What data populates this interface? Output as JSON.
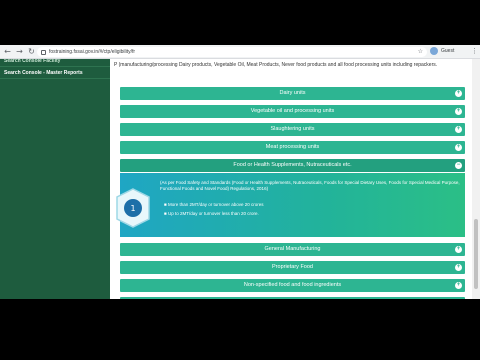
{
  "browser": {
    "url": "fostraining.fssai.gov.in/#/ctp/eligibility/fr",
    "profile": "Guest"
  },
  "sidebar": {
    "items": [
      {
        "label": "Search Console Facility"
      },
      {
        "label": "Search Console - Master Reports"
      }
    ]
  },
  "main": {
    "intro": "P (manufacturing/processing Dairy products, Vegetable Oil, Meat Products, Never food products and all food processing units including repackers.",
    "accordion": [
      {
        "label": "Dairy units"
      },
      {
        "label": "Vegetable oil and processing units"
      },
      {
        "label": "Slaughtering units"
      },
      {
        "label": "Meat processing units"
      },
      {
        "label": "Food or Health Supplements, Nutraceuticals etc."
      },
      {
        "label": "General Manufacturing"
      },
      {
        "label": "Proprietary Food"
      },
      {
        "label": "Non-specified food and food ingredients"
      }
    ],
    "panel": {
      "text": "(As per Food Safety and Standards (Food or Health Supplements, Nutraceuticals, Foods for Special Dietary Uses, Foods for Special Medical Purpose, Functional Foods and Novel Food) Regulations, 2016)",
      "bullets": [
        "More than 2MT/day or turnover above 20 crores",
        "Up to 2MT/day or turnover less than 20 crore."
      ]
    }
  }
}
